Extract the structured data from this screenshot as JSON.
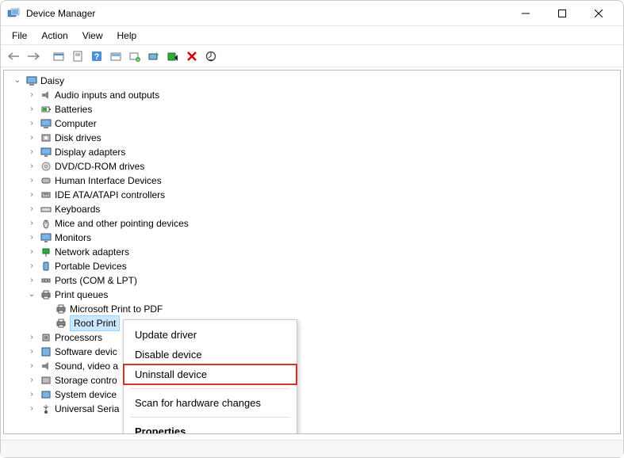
{
  "window": {
    "title": "Device Manager"
  },
  "menubar": {
    "items": [
      "File",
      "Action",
      "View",
      "Help"
    ]
  },
  "toolbar": {
    "back": "back-arrow",
    "forward": "forward-arrow",
    "buttons": [
      {
        "name": "show-hidden-icon"
      },
      {
        "name": "properties-icon"
      },
      {
        "name": "help-icon"
      },
      {
        "name": "scan-devices-icon"
      },
      {
        "name": "add-hardware-icon"
      },
      {
        "name": "update-driver-icon"
      },
      {
        "name": "disable-device-icon"
      },
      {
        "name": "uninstall-icon"
      },
      {
        "name": "scan-hardware-changes-icon"
      }
    ]
  },
  "tree": {
    "root": {
      "label": "Daisy",
      "expanded": true
    },
    "categories": [
      {
        "label": "Audio inputs and outputs",
        "icon": "audio-icon"
      },
      {
        "label": "Batteries",
        "icon": "battery-icon"
      },
      {
        "label": "Computer",
        "icon": "computer-icon"
      },
      {
        "label": "Disk drives",
        "icon": "disk-icon"
      },
      {
        "label": "Display adapters",
        "icon": "display-icon"
      },
      {
        "label": "DVD/CD-ROM drives",
        "icon": "cdrom-icon"
      },
      {
        "label": "Human Interface Devices",
        "icon": "hid-icon"
      },
      {
        "label": "IDE ATA/ATAPI controllers",
        "icon": "ide-icon"
      },
      {
        "label": "Keyboards",
        "icon": "keyboard-icon"
      },
      {
        "label": "Mice and other pointing devices",
        "icon": "mouse-icon"
      },
      {
        "label": "Monitors",
        "icon": "monitor-icon"
      },
      {
        "label": "Network adapters",
        "icon": "network-icon"
      },
      {
        "label": "Portable Devices",
        "icon": "portable-icon"
      },
      {
        "label": "Ports (COM & LPT)",
        "icon": "port-icon"
      }
    ],
    "printqueues": {
      "label": "Print queues",
      "icon": "printer-icon",
      "expanded": true,
      "children": [
        {
          "label": "Microsoft Print to PDF",
          "icon": "printer-icon"
        },
        {
          "label": "Root Print Queue",
          "icon": "printer-icon",
          "selected": true,
          "visible_label": "Root Print"
        }
      ]
    },
    "after": [
      {
        "label": "Processors",
        "icon": "cpu-icon"
      },
      {
        "label": "Software devic",
        "icon": "software-icon"
      },
      {
        "label": "Sound, video a",
        "icon": "sound-icon"
      },
      {
        "label": "Storage contro",
        "icon": "storage-icon"
      },
      {
        "label": "System device",
        "icon": "system-icon"
      },
      {
        "label": "Universal Seria",
        "icon": "usb-icon"
      }
    ]
  },
  "context_menu": {
    "items": [
      {
        "label": "Update driver"
      },
      {
        "label": "Disable device"
      },
      {
        "label": "Uninstall device",
        "highlighted": true
      },
      {
        "sep": true
      },
      {
        "label": "Scan for hardware changes"
      },
      {
        "sep": true
      },
      {
        "label": "Properties",
        "bold": true
      }
    ]
  }
}
